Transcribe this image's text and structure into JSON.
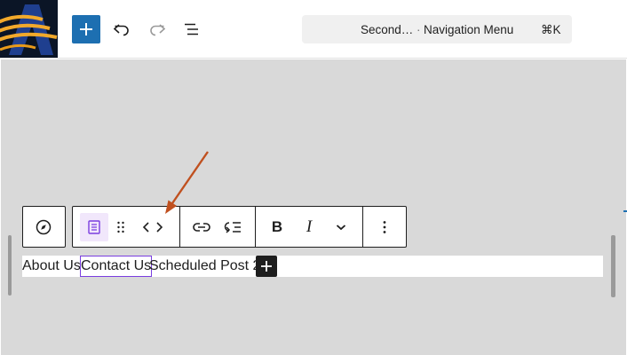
{
  "header": {
    "command_bar": {
      "title": "Second…",
      "separator": "·",
      "context": "Navigation Menu",
      "shortcut": "⌘K"
    }
  },
  "toolbar": {
    "icons": [
      "compass-icon",
      "page-icon",
      "drag-handle-icon",
      "code-brackets-icon",
      "link-icon",
      "submenu-icon",
      "bold-icon",
      "italic-icon",
      "chevron-down-icon",
      "more-options-icon"
    ],
    "bold_label": "B",
    "italic_label": "I"
  },
  "navigation": {
    "items": [
      {
        "label": "About Us"
      },
      {
        "label": "Contact Us",
        "selected": true
      },
      {
        "label": "Scheduled Post 2"
      }
    ]
  },
  "colors": {
    "accent_blue": "#1d6fb1",
    "selection_purple": "#7a3ee0",
    "canvas_gray": "#d9d9d9",
    "arrow": "#c0501f"
  }
}
